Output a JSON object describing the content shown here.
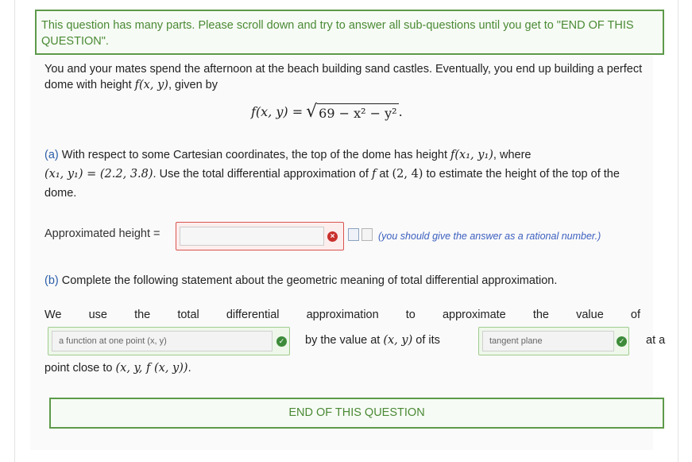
{
  "notice": "This question has many parts. Please scroll down and try to answer all sub-questions until you get to \"END OF THIS QUESTION\".",
  "intro": {
    "line1": "You and your mates spend the afternoon at the beach building sand castles. Eventually, you end up building a perfect",
    "line2a": "dome with height ",
    "line2b": ", given by"
  },
  "formula": {
    "lhs": "f(x, y) = ",
    "radicand": "69 − x² − y²",
    "end": "."
  },
  "part_a": {
    "label": "(a)",
    "text1": " With respect to some Cartesian coordinates, the top of the dome has height ",
    "fx1": "f(x₁, y₁)",
    "text2": ", where",
    "eq": "(x₁, y₁) = (2.2, 3.8)",
    "text3": ". Use the total differential approximation of ",
    "f": "f",
    "text4": " at ",
    "pt": "(2, 4)",
    "text5": " to estimate the height of the top of the",
    "text6": "dome.",
    "answer_label": "Approximated height =",
    "answer_value": "",
    "hint": "(you should give the answer as a rational number.)"
  },
  "part_b": {
    "label": "(b)",
    "text": " Complete the following statement about the geometric meaning of total differential approximation.",
    "words": [
      "We",
      "use",
      "the",
      "total",
      "differential",
      "approximation",
      "to",
      "approximate",
      "the",
      "value",
      "of"
    ],
    "select1": "a function at one point (x, y)",
    "mid_text": "by the value at ",
    "mid_xy": "(x, y)",
    "mid_text2": " of its",
    "select2": "tangent plane",
    "at_a": "at a",
    "line3a": "point close to ",
    "line3b": "(x, y, f (x, y))",
    "line3c": "."
  },
  "end_label": "END OF THIS QUESTION"
}
